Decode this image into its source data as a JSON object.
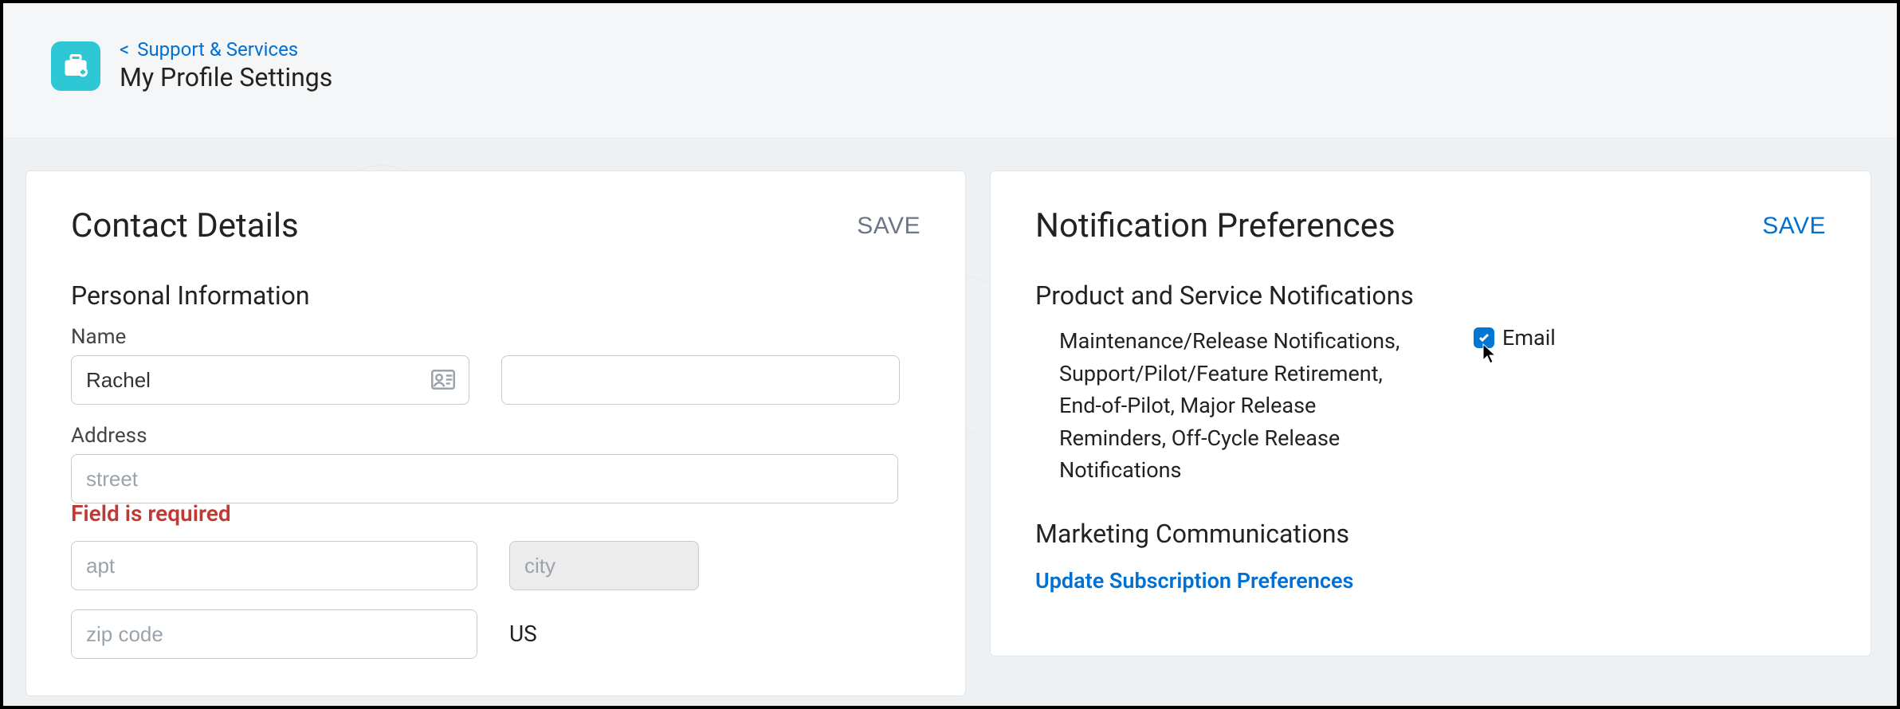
{
  "header": {
    "breadcrumb_label": "Support & Services",
    "page_title": "My Profile Settings"
  },
  "contact_card": {
    "title": "Contact Details",
    "save_label": "SAVE",
    "section_personal": "Personal Information",
    "name_label": "Name",
    "first_name_value": "Rachel",
    "last_name_value": "",
    "address_label": "Address",
    "street_placeholder": "street",
    "street_value": "",
    "street_error": "Field is required",
    "apt_placeholder": "apt",
    "apt_value": "",
    "city_placeholder": "city",
    "city_value": "",
    "zip_placeholder": "zip code",
    "zip_value": "",
    "country_value": "US"
  },
  "notif_card": {
    "title": "Notification Preferences",
    "save_label": "SAVE",
    "section_product": "Product and Service Notifications",
    "product_desc": "Maintenance/Release Notifications, Support/Pilot/Feature Retirement, End-of-Pilot, Major Release Reminders, Off-Cycle Release Notifications",
    "email_label": "Email",
    "email_checked": true,
    "section_marketing": "Marketing Communications",
    "pref_link_label": "Update Subscription Preferences"
  }
}
